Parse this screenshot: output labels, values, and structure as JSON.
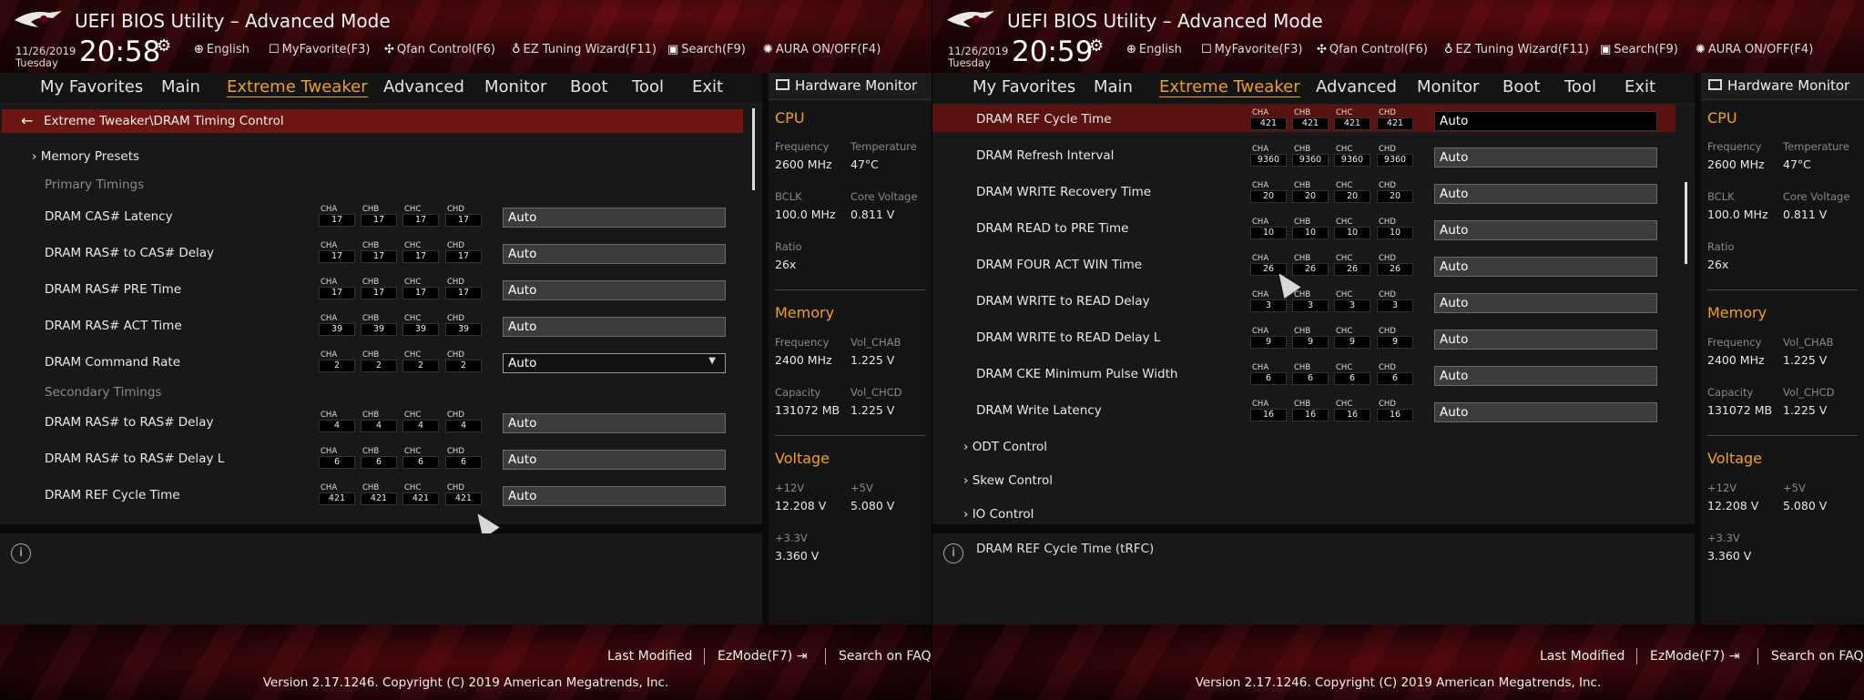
{
  "app_title": "UEFI BIOS Utility – Advanced Mode",
  "toolbar": {
    "language": "English",
    "myfavorite": "MyFavorite(F3)",
    "qfan": "Qfan Control(F6)",
    "ez_tuning": "EZ Tuning Wizard(F11)",
    "search": "Search(F9)",
    "aura": "AURA ON/OFF(F4)"
  },
  "nav_tabs": [
    "My Favorites",
    "Main",
    "Extreme Tweaker",
    "Advanced",
    "Monitor",
    "Boot",
    "Tool",
    "Exit"
  ],
  "active_tab": "Extreme Tweaker",
  "channel_names": [
    "CHA",
    "CHB",
    "CHC",
    "CHD"
  ],
  "hardware_monitor": {
    "title": "Hardware Monitor",
    "cpu": {
      "heading": "CPU",
      "frequency_label": "Frequency",
      "frequency": "2600 MHz",
      "temperature_label": "Temperature",
      "temperature": "47°C",
      "bclk_label": "BCLK",
      "bclk": "100.0 MHz",
      "core_voltage_label": "Core Voltage",
      "core_voltage": "0.811 V",
      "ratio_label": "Ratio",
      "ratio": "26x"
    },
    "memory": {
      "heading": "Memory",
      "frequency_label": "Frequency",
      "frequency": "2400 MHz",
      "vol_chab_label": "Vol_CHAB",
      "vol_chab": "1.225 V",
      "capacity_label": "Capacity",
      "capacity": "131072 MB",
      "vol_chcd_label": "Vol_CHCD",
      "vol_chcd": "1.225 V"
    },
    "voltage": {
      "heading": "Voltage",
      "v12_label": "+12V",
      "v12": "12.208 V",
      "v5_label": "+5V",
      "v5": "5.080 V",
      "v33_label": "+3.3V",
      "v33": "3.360 V"
    }
  },
  "footer": {
    "last_modified": "Last Modified",
    "ezmode": "EzMode(F7)",
    "search_faq": "Search on FAQ",
    "version": "Version 2.17.1246. Copyright (C) 2019 American Megatrends, Inc."
  },
  "left": {
    "date": "11/26/2019",
    "day": "Tuesday",
    "time": "20:58",
    "breadcrumb": "Extreme Tweaker\\DRAM Timing Control",
    "memory_presets": "Memory Presets",
    "primary_header": "Primary Timings",
    "secondary_header": "Secondary Timings",
    "rows": [
      {
        "label": "DRAM CAS# Latency",
        "values": [
          "17",
          "17",
          "17",
          "17"
        ],
        "setting": "Auto"
      },
      {
        "label": "DRAM RAS# to CAS# Delay",
        "values": [
          "17",
          "17",
          "17",
          "17"
        ],
        "setting": "Auto"
      },
      {
        "label": "DRAM RAS# PRE Time",
        "values": [
          "17",
          "17",
          "17",
          "17"
        ],
        "setting": "Auto"
      },
      {
        "label": "DRAM RAS# ACT Time",
        "values": [
          "39",
          "39",
          "39",
          "39"
        ],
        "setting": "Auto"
      },
      {
        "label": "DRAM Command Rate",
        "values": [
          "2",
          "2",
          "2",
          "2"
        ],
        "setting": "Auto"
      },
      {
        "label": "DRAM RAS# to RAS# Delay",
        "values": [
          "4",
          "4",
          "4",
          "4"
        ],
        "setting": "Auto"
      },
      {
        "label": "DRAM RAS# to RAS# Delay L",
        "values": [
          "6",
          "6",
          "6",
          "6"
        ],
        "setting": "Auto"
      },
      {
        "label": "DRAM REF Cycle Time",
        "values": [
          "421",
          "421",
          "421",
          "421"
        ],
        "setting": "Auto"
      }
    ],
    "info_text": ""
  },
  "right": {
    "date": "11/26/2019",
    "day": "Tuesday",
    "time": "20:59",
    "rows": [
      {
        "label": "DRAM REF Cycle Time",
        "values": [
          "421",
          "421",
          "421",
          "421"
        ],
        "setting": "Auto"
      },
      {
        "label": "DRAM Refresh Interval",
        "values": [
          "9360",
          "9360",
          "9360",
          "9360"
        ],
        "setting": "Auto"
      },
      {
        "label": "DRAM WRITE Recovery Time",
        "values": [
          "20",
          "20",
          "20",
          "20"
        ],
        "setting": "Auto"
      },
      {
        "label": "DRAM READ to PRE Time",
        "values": [
          "10",
          "10",
          "10",
          "10"
        ],
        "setting": "Auto"
      },
      {
        "label": "DRAM FOUR ACT WIN Time",
        "values": [
          "26",
          "26",
          "26",
          "26"
        ],
        "setting": "Auto"
      },
      {
        "label": "DRAM WRITE to READ Delay",
        "values": [
          "3",
          "3",
          "3",
          "3"
        ],
        "setting": "Auto"
      },
      {
        "label": "DRAM WRITE to READ Delay L",
        "values": [
          "9",
          "9",
          "9",
          "9"
        ],
        "setting": "Auto"
      },
      {
        "label": "DRAM CKE Minimum Pulse Width",
        "values": [
          "6",
          "6",
          "6",
          "6"
        ],
        "setting": "Auto"
      },
      {
        "label": "DRAM Write Latency",
        "values": [
          "16",
          "16",
          "16",
          "16"
        ],
        "setting": "Auto"
      }
    ],
    "submenus": [
      "ODT Control",
      "Skew Control",
      "IO Control"
    ],
    "info_text": "DRAM REF Cycle Time (tRFC)"
  },
  "colors": {
    "accent": "#f0a020",
    "highlight_row": "#5a1211",
    "breadcrumb_bg": "#6d1513"
  },
  "icons": [
    "rog-logo",
    "gear-icon",
    "globe-icon",
    "star-icon",
    "fan-icon",
    "bulb-icon",
    "search-icon",
    "aura-icon",
    "back-arrow-icon",
    "chevron-right-icon",
    "dropdown-caret-icon",
    "monitor-icon",
    "info-icon",
    "ezmode-exit-icon",
    "mouse-cursor"
  ]
}
